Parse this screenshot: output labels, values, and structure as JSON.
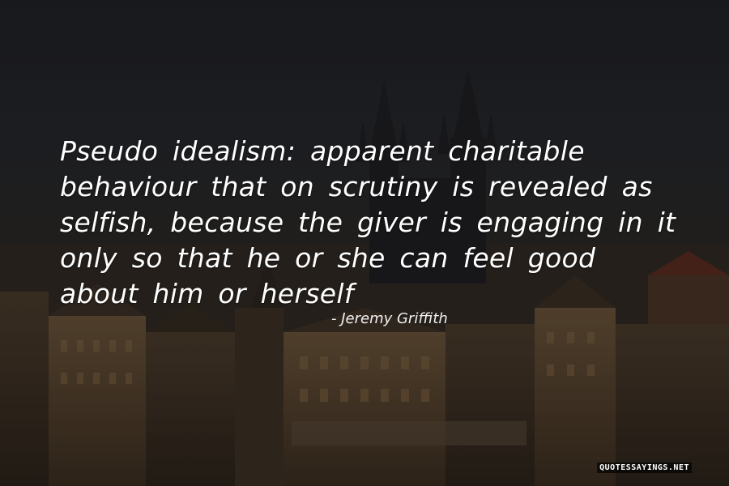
{
  "quote": {
    "text": "Pseudo idealism: apparent charitable behaviour that on scrutiny is revealed as selfish, because the giver is engaging in it only so that he or she can feel good about him or herself",
    "author": "- Jeremy Griffith"
  },
  "watermark": {
    "text": "QUOTESSAYINGS.NET"
  },
  "background": {
    "icon": "city-skyline-background",
    "sky_color": "#23252a",
    "building_color": "#5a4530"
  }
}
